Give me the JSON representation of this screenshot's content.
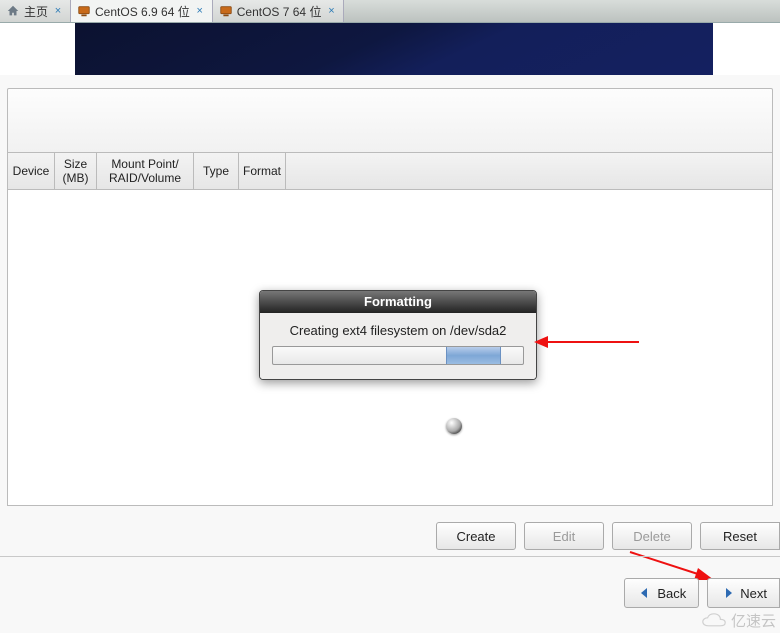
{
  "tabs": [
    {
      "label": "主页",
      "active": false
    },
    {
      "label": "CentOS 6.9 64 位",
      "active": true
    },
    {
      "label": "CentOS 7 64 位",
      "active": false
    }
  ],
  "columns": {
    "device": "Device",
    "size_l1": "Size",
    "size_l2": "(MB)",
    "mp_l1": "Mount Point/",
    "mp_l2": "RAID/Volume",
    "type": "Type",
    "format": "Format"
  },
  "dialog": {
    "title": "Formatting",
    "message": "Creating ext4 filesystem on /dev/sda2",
    "progress_left_pct": 69,
    "progress_width_pct": 22
  },
  "buttons": {
    "create": "Create",
    "edit": "Edit",
    "delete": "Delete",
    "reset": "Reset",
    "back": "Back",
    "next": "Next"
  },
  "watermark": "亿速云"
}
